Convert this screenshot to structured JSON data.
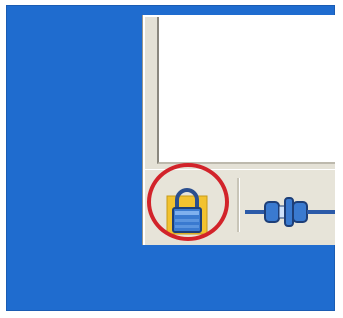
{
  "taskbar": {
    "tray_icons": [
      {
        "name": "security-lock-icon",
        "state": "highlighted"
      },
      {
        "name": "network-connection-icon"
      }
    ],
    "highlight_color": "#d2232a"
  },
  "colors": {
    "desktop": "#1f6ccf",
    "window_face": "#e4e1d6",
    "lock_yellow": "#f2c230",
    "lock_blue": "#3a7ad0"
  }
}
